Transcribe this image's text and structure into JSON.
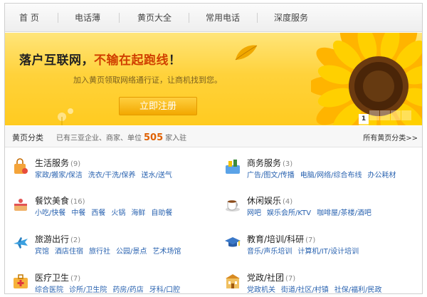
{
  "nav": {
    "items": [
      "首 页",
      "电话薄",
      "黄页大全",
      "常用电话",
      "深度服务"
    ]
  },
  "banner": {
    "headline_a": "落户互联网，",
    "headline_b": "不输在起跑线",
    "headline_c": "！",
    "subtitle": "加入黄页领取网络通行证，让商机找到您。",
    "button": "立即注册",
    "pager": [
      "1",
      "",
      "",
      "",
      "",
      ""
    ]
  },
  "category_header": {
    "title": "黄页分类",
    "stat_prefix": "已有三亚企业、商家、单位",
    "stat_count": "505",
    "stat_suffix": "家入驻",
    "all_link": "所有黄页分类>>"
  },
  "categories": [
    {
      "name": "生活服务",
      "count": "(9)",
      "icon": "shopping-bag-icon",
      "subs": [
        "家政/搬家/保洁",
        "洗衣/干洗/保养",
        "送水/送气"
      ]
    },
    {
      "name": "商务服务",
      "count": "(3)",
      "icon": "tools-icon",
      "subs": [
        "广告/图文/传播",
        "电脑/网络/综合布线",
        "办公耗材"
      ]
    },
    {
      "name": "餐饮美食",
      "count": "(16)",
      "icon": "cake-icon",
      "subs": [
        "小吃/快餐",
        "中餐",
        "西餐",
        "火锅",
        "海鲜",
        "自助餐"
      ]
    },
    {
      "name": "休闲娱乐",
      "count": "(4)",
      "icon": "coffee-cup-icon",
      "subs": [
        "网吧",
        "娱乐会所/KTV",
        "咖啡屋/茶楼/酒吧"
      ]
    },
    {
      "name": "旅游出行",
      "count": "(2)",
      "icon": "airplane-icon",
      "subs": [
        "宾馆",
        "酒店住宿",
        "旅行社",
        "公园/景点",
        "艺术场馆"
      ]
    },
    {
      "name": "教育/培训/科研",
      "count": "(7)",
      "icon": "graduation-cap-icon",
      "subs": [
        "音乐/声乐培训",
        "计算机/IT/设计培训"
      ]
    },
    {
      "name": "医疗卫生",
      "count": "(7)",
      "icon": "medical-kit-icon",
      "subs": [
        "综合医院",
        "诊所/卫生院",
        "药房/药店",
        "牙科/口腔"
      ]
    },
    {
      "name": "党政/社团",
      "count": "(7)",
      "icon": "building-icon",
      "subs": [
        "党政机关",
        "街道/社区/村镇",
        "社保/福利/民政"
      ]
    }
  ]
}
